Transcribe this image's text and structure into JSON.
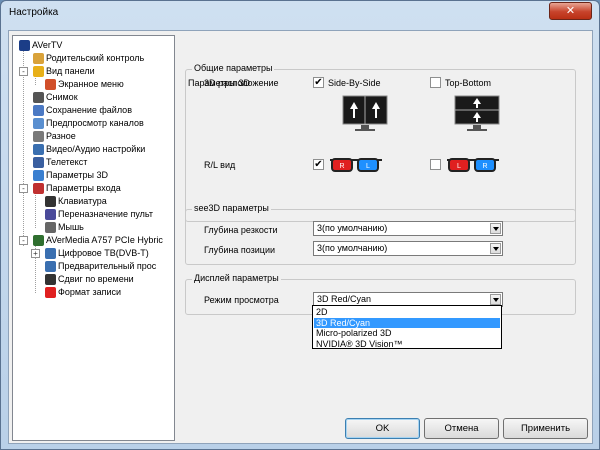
{
  "window": {
    "title": "Настройка",
    "close_glyph": "✕"
  },
  "tree": [
    {
      "label": "AVerTV",
      "icon": "avertv-icon",
      "color": "#1b3d87"
    },
    {
      "label": "Родительский контроль",
      "icon": "parental-icon",
      "color": "#d9a23a"
    },
    {
      "label": "Вид панели",
      "icon": "panel-icon",
      "color": "#e8b019"
    },
    {
      "label": "Экранное меню",
      "icon": "osd-icon",
      "color": "#d14f2a"
    },
    {
      "label": "Снимок",
      "icon": "snapshot-icon",
      "color": "#555555"
    },
    {
      "label": "Сохранение файлов",
      "icon": "save-files-icon",
      "color": "#4b79c4"
    },
    {
      "label": "Предпросмотр каналов",
      "icon": "preview-icon",
      "color": "#5a8fd0"
    },
    {
      "label": "Разное",
      "icon": "misc-icon",
      "color": "#7a7a7a"
    },
    {
      "label": "Видео/Аудио настройки",
      "icon": "av-settings-icon",
      "color": "#3a6fb0"
    },
    {
      "label": "Телетекст",
      "icon": "teletext-icon",
      "color": "#3a5fa0"
    },
    {
      "label": "Параметры 3D",
      "icon": "3d-icon",
      "color": "#3a7fd0"
    },
    {
      "label": "Параметры входа",
      "icon": "input-icon",
      "color": "#c03030"
    },
    {
      "label": "Клавиатура",
      "icon": "keyboard-icon",
      "color": "#333333"
    },
    {
      "label": "Переназначение пульт",
      "icon": "remote-icon",
      "color": "#4a4a9a"
    },
    {
      "label": "Мышь",
      "icon": "mouse-icon",
      "color": "#666666"
    },
    {
      "label": "AVerMedia A757 PCIe Hybric",
      "icon": "device-icon",
      "color": "#2f6f2f"
    },
    {
      "label": "Цифровое ТВ(DVB-T)",
      "icon": "dvbt-icon",
      "color": "#3a6fb0"
    },
    {
      "label": "Предварительный прос",
      "icon": "prebuffer-icon",
      "color": "#3a6fb0"
    },
    {
      "label": "Сдвиг по времени",
      "icon": "timeshift-icon",
      "color": "#333333"
    },
    {
      "label": "Формат записи",
      "icon": "record-icon",
      "color": "#e02020"
    }
  ],
  "panel": {
    "title": "Параметры 3D",
    "general": {
      "title": "Общие параметры",
      "layout_label": "3D расположение",
      "sbs_label": "Side-By-Side",
      "sbs_checked": "✔",
      "tb_label": "Top-Bottom",
      "tb_checked": "",
      "rl_label": "R/L вид",
      "rl1_checked": "✔",
      "rl2_checked": "",
      "glasses_left": "R",
      "glasses_right": "L",
      "glasses2_left": "L",
      "glasses2_right": "R"
    },
    "see3d": {
      "title": "see3D параметры",
      "sharpness_label": "Глубина резкости",
      "sharpness_value": "3(по умолчанию)",
      "position_label": "Глубина позиции",
      "position_value": "3(по умолчанию)"
    },
    "display": {
      "title": "Дисплей параметры",
      "mode_label": "Режим просмотра",
      "mode_value": "3D Red/Cyan",
      "options": [
        "2D",
        "3D Red/Cyan",
        "Micro-polarized 3D",
        "NVIDIA® 3D Vision™"
      ],
      "highlighted_index": 1
    }
  },
  "buttons": {
    "ok": "OK",
    "cancel": "Отмена",
    "apply": "Применить"
  }
}
